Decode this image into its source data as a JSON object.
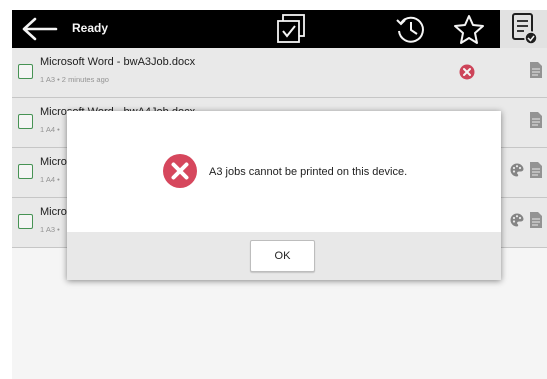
{
  "header": {
    "back_icon": "arrow-left-icon",
    "title": "Ready",
    "icons": [
      "select-all-icon",
      "history-icon",
      "star-icon",
      "document-list-icon"
    ]
  },
  "jobs": [
    {
      "name": "Microsoft Word - bwA3Job.docx",
      "meta": "1 A3 • 2 minutes ago",
      "status_icon": "error-icon"
    },
    {
      "name": "Microsoft Word - bwA4Job.docx",
      "meta": "1 A4 •"
    },
    {
      "name": "Micro",
      "meta": "1 A4 •",
      "color_icon": "palette-icon"
    },
    {
      "name": "Micro",
      "meta": "1 A3 •",
      "color_icon": "palette-icon"
    }
  ],
  "dialog": {
    "icon": "error-icon",
    "message": "A3 jobs cannot be printed on this device.",
    "ok_label": "OK"
  },
  "colors": {
    "topbar": "#000000",
    "error": "#d6475d",
    "checkbox": "#4a9a58",
    "row_bg": "#f3f3f3",
    "dialog_footer": "#e8e8e8"
  }
}
